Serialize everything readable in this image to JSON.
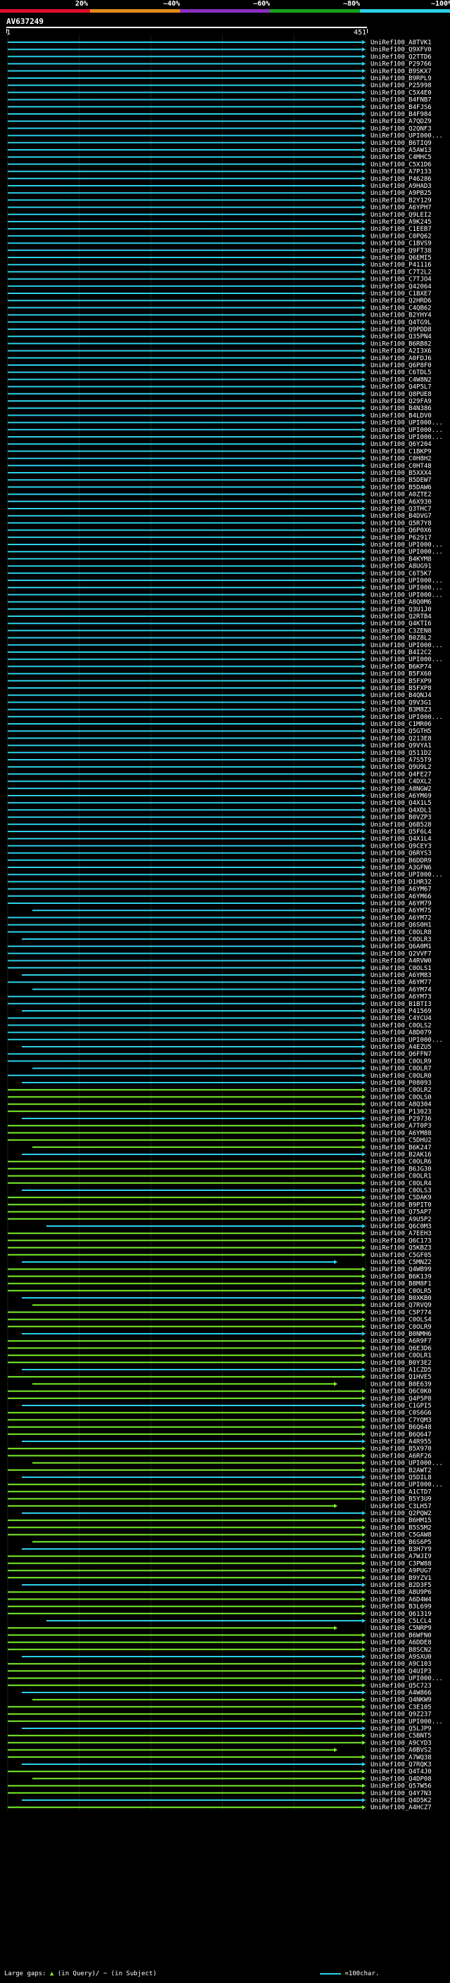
{
  "identity_scale": {
    "labels": [
      "20%",
      "~40%",
      "~60%",
      "~80%",
      "~100%"
    ],
    "colors": [
      "#e0102f",
      "#e08a1a",
      "#8a2fc0",
      "#18a018",
      "#2dd0e8"
    ]
  },
  "query": {
    "name": "AV637249",
    "start": "1",
    "end": "451"
  },
  "footer": {
    "gaps_label": "Large gaps:",
    "query_gap": "(in Query)/",
    "subject_gap": "~ (in Subject)",
    "scale_label": "=100char."
  },
  "colors": {
    "full_identity": "#2dd0e8",
    "partial_identity": "#7aef2b",
    "grid": "#0c2b0c"
  },
  "hits": [
    "UniRef100_A8TVK1",
    "UniRef100_Q9XFV0",
    "UniRef100_Q2TTD6",
    "UniRef100_P29766",
    "UniRef100_B9SKX7",
    "UniRef100_B9RPL9",
    "UniRef100_P25998",
    "UniRef100_C5X4E0",
    "UniRef100_B4FNB7",
    "UniRef100_B4FJS6",
    "UniRef100_B4F984",
    "UniRef100_A7QDZ9",
    "UniRef100_Q2QNF3",
    "UniRef100_UPI000...",
    "UniRef100_B6TIQ9",
    "UniRef100_A5AW13",
    "UniRef100_C4MHC5",
    "UniRef100_C5X1D6",
    "UniRef100_A7P133",
    "UniRef100_P46286",
    "UniRef100_A9HAD3",
    "UniRef100_A9PB25",
    "UniRef100_B2Y129",
    "UniRef100_A6YPH7",
    "UniRef100_Q9LEI2",
    "UniRef100_A9K245",
    "UniRef100_C1EEB7",
    "UniRef100_C0PQ62",
    "UniRef100_C1BVS9",
    "UniRef100_Q9FT38",
    "UniRef100_Q6EMI5",
    "UniRef100_P41116",
    "UniRef100_C7T2L2",
    "UniRef100_C7TJO4",
    "UniRef100_Q42064",
    "UniRef100_C1BXE7",
    "UniRef100_Q2HRD6",
    "UniRef100_C4QB62",
    "UniRef100_B2YHY4",
    "UniRef100_Q4TG9L",
    "UniRef100_Q9PDD8",
    "UniRef100_Q35PN4",
    "UniRef100_B6RB82",
    "UniRef100_A2I3X6",
    "UniRef100_A0FDJ6",
    "UniRef100_Q6P8F0",
    "UniRef100_C6TDL5",
    "UniRef100_C4W8N2",
    "UniRef100_Q4P5L7",
    "UniRef100_Q8PUE8",
    "UniRef100_Q29FA9",
    "UniRef100_B4N386",
    "UniRef100_B4LDV0",
    "UniRef100_UPI000...",
    "UniRef100_UPI000...",
    "UniRef100_UPI000...",
    "UniRef100_Q6Y204",
    "UniRef100_C1BKP9",
    "UniRef100_C0H8H2",
    "UniRef100_C0HT48",
    "UniRef100_B5XXX4",
    "UniRef100_B5DEW7",
    "UniRef100_B5DAW6",
    "UniRef100_A0ZTE2",
    "UniRef100_A6X930",
    "UniRef100_Q3THC7",
    "UniRef100_B4DVG7",
    "UniRef100_Q5R7Y8",
    "UniRef100_Q6P0X6",
    "UniRef100_P62917",
    "UniRef100_UPI000...",
    "UniRef100_UPI000...",
    "UniRef100_B4KYM8",
    "UniRef100_A8UG91",
    "UniRef100_C6T5K7",
    "UniRef100_UPI000...",
    "UniRef100_UPI000...",
    "UniRef100_UPI000...",
    "UniRef100_A8Q0M6",
    "UniRef100_Q3U1J0",
    "UniRef100_Q2RTB4",
    "UniRef100_Q4KTI6",
    "UniRef100_C3ZEN8",
    "UniRef100_B0Z8L2",
    "UniRef100_UPI000...",
    "UniRef100_B4I2C2",
    "UniRef100_UPI000...",
    "UniRef100_B6KP74",
    "UniRef100_B5FX60",
    "UniRef100_B5FXP9",
    "UniRef100_B5FXP8",
    "UniRef100_B4QNJ4",
    "UniRef100_Q9V3G1",
    "UniRef100_B3M8Z3",
    "UniRef100_UPI000...",
    "UniRef100_C1MR06",
    "UniRef100_Q5GTH5",
    "UniRef100_Q213E8",
    "UniRef100_Q9VYA1",
    "UniRef100_Q511D2",
    "UniRef100_A7S5T9",
    "UniRef100_Q9U9L2",
    "UniRef100_Q4FE27",
    "UniRef100_C4DXL2",
    "UniRef100_A8NGW2",
    "UniRef100_A6YM69",
    "UniRef100_Q4X1L5",
    "UniRef100_Q4XDL1",
    "UniRef100_B0VZP3",
    "UniRef100_Q6B528",
    "UniRef100_Q5F6L4",
    "UniRef100_Q4X1L4",
    "UniRef100_Q9CEY3",
    "UniRef100_Q6RYS3",
    "UniRef100_B6DDR9",
    "UniRef100_A3GFN6",
    "UniRef100_UPI000...",
    "UniRef100_D1HR32",
    "UniRef100_A6YM67",
    "UniRef100_A6YM66",
    "UniRef100_A6YM79",
    "UniRef100_A6YM75",
    "UniRef100_A6YM72",
    "UniRef100_Q6S0H1",
    "UniRef100_C0OLR8",
    "UniRef100_C0OLR3",
    "UniRef100_Q6A0M1",
    "UniRef100_Q2VVF7",
    "UniRef100_A4RVW0",
    "UniRef100_C0OLS1",
    "UniRef100_A6YM83",
    "UniRef100_A6YM77",
    "UniRef100_A6YM74",
    "UniRef100_A6YM73",
    "UniRef100_B1BTI3",
    "UniRef100_P41569",
    "UniRef100_C4YCU4",
    "UniRef100_C0OLS2",
    "UniRef100_A8D079",
    "UniRef100_UPI000...",
    "UniRef100_A4EZU5",
    "UniRef100_Q6FFN7",
    "UniRef100_C0OLR9",
    "UniRef100_C0OLR7",
    "UniRef100_C0OLR0",
    "UniRef100_P08093",
    "UniRef100_C0OLR2",
    "UniRef100_C0OLS0",
    "UniRef100_A8Q304",
    "UniRef100_P13023",
    "UniRef100_P29736",
    "UniRef100_A7T0P3",
    "UniRef100_A6YM88",
    "UniRef100_C5DHU2",
    "UniRef100_B6K247",
    "UniRef100_B2AK16",
    "UniRef100_C0OLR6",
    "UniRef100_B6JG30",
    "UniRef100_C0OLR1",
    "UniRef100_C0OLR4",
    "UniRef100_C0OLS3",
    "UniRef100_C5DAK9",
    "UniRef100_B9PIT0",
    "UniRef100_Q75AP7",
    "UniRef100_A9U5P2",
    "UniRef100_Q6C0M3",
    "UniRef100_A7EEH3",
    "UniRef100_Q6C173",
    "UniRef100_Q5KBZ3",
    "UniRef100_C5GF05",
    "UniRef100_C5MNZ2",
    "UniRef100_Q4WB99",
    "UniRef100_B6K139",
    "UniRef100_B8M8F1",
    "UniRef100_C0OLR5",
    "UniRef100_B0XKB0",
    "UniRef100_Q7RVQ9",
    "UniRef100_C5P774",
    "UniRef100_C0OLS4",
    "UniRef100_C0OLR9",
    "UniRef100_B0NMH6",
    "UniRef100_A6R9F7",
    "UniRef100_Q6E3D6",
    "UniRef100_C0OLR1",
    "UniRef100_B0Y3E2",
    "UniRef100_A1CZD5",
    "UniRef100_Q1HVE5",
    "UniRef100_B0E639",
    "UniRef100_Q6C0K0",
    "UniRef100_Q4P5P8",
    "UniRef100_C1GPI5",
    "UniRef100_C0S6G6",
    "UniRef100_C7YQM3",
    "UniRef100_B6Q648",
    "UniRef100_B6Q647",
    "UniRef100_A4R955",
    "UniRef100_B5X970",
    "UniRef100_A6RF26",
    "UniRef100_UPI000...",
    "UniRef100_B2AWT2",
    "UniRef100_Q5DIL8",
    "UniRef100_UPI000...",
    "UniRef100_A1CTD7",
    "UniRef100_B5Y3U9",
    "UniRef100_C3LH57",
    "UniRef100_Q2PQW2",
    "UniRef100_B6HM15",
    "UniRef100_B5S5M2",
    "UniRef100_C5GAW8",
    "UniRef100_B6S6P5",
    "UniRef100_B3H7Y9",
    "UniRef100_A7WJI9",
    "UniRef100_C3PW88",
    "UniRef100_A9PUG7",
    "UniRef100_B9YZV1",
    "UniRef100_B2D3F5",
    "UniRef100_A8U9P6",
    "UniRef100_A6D4W4",
    "UniRef100_B3L699",
    "UniRef100_Q61319",
    "UniRef100_C5LCL4",
    "UniRef100_C5NRP9",
    "UniRef100_B6WFN0",
    "UniRef100_A6DDE8",
    "UniRef100_B8SCN2",
    "UniRef100_A9SXU0",
    "UniRef100_A9C103",
    "UniRef100_Q4UIP3",
    "UniRef100_UPI000...",
    "UniRef100_Q5C723",
    "UniRef100_A4W866",
    "UniRef100_Q4NKW9",
    "UniRef100_C3E105",
    "UniRef100_Q9Z237",
    "UniRef100_UPI000...",
    "UniRef100_Q5LJP9",
    "UniRef100_C5BNT5",
    "UniRef100_A9CYD3",
    "UniRef100_A0BVS2",
    "UniRef100_A7WQ38",
    "UniRef100_Q7RQK3",
    "UniRef100_Q4T4J0",
    "UniRef100_Q4DP08",
    "UniRef100_Q57W56",
    "UniRef100_Q4Y7N3",
    "UniRef100_Q4D5K2",
    "UniRef100_A4HCZ7"
  ]
}
